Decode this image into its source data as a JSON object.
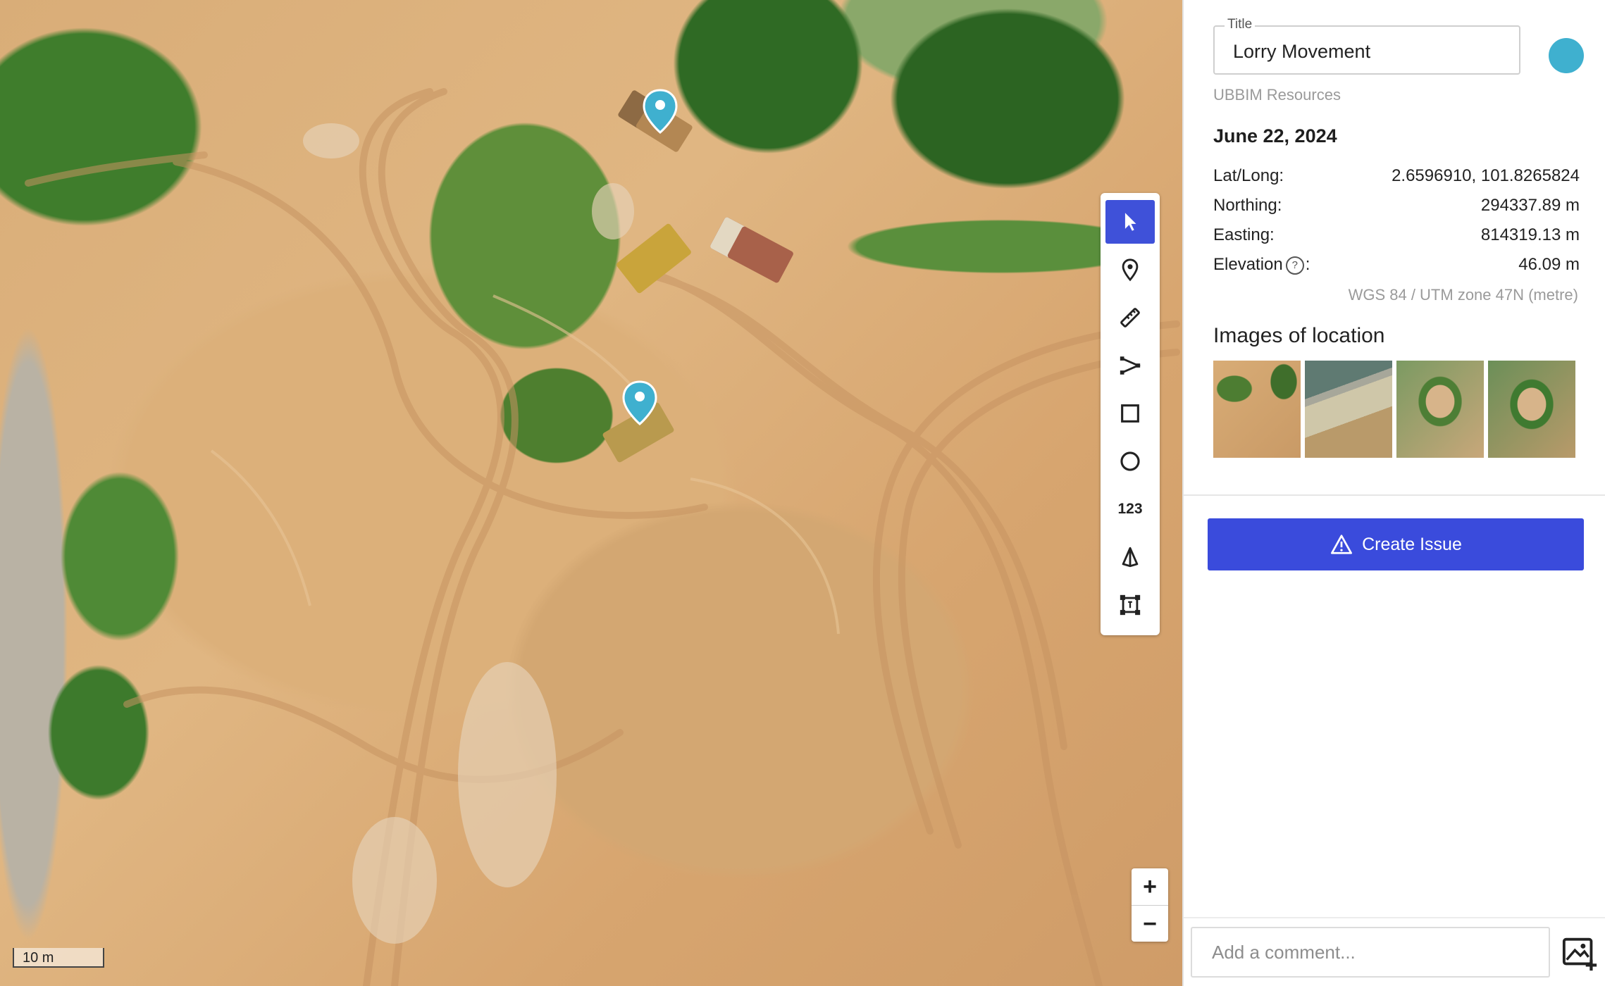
{
  "map": {
    "scale_label": "10 m",
    "zoom_in_label": "+",
    "zoom_out_label": "−",
    "tools": [
      {
        "name": "select-tool",
        "icon": "cursor-arrow-icon",
        "active": true
      },
      {
        "name": "point-tool",
        "icon": "map-pin-icon"
      },
      {
        "name": "distance-tool",
        "icon": "ruler-icon"
      },
      {
        "name": "polyline-tool",
        "icon": "polyline-icon"
      },
      {
        "name": "rectangle-tool",
        "icon": "square-icon"
      },
      {
        "name": "circle-tool",
        "icon": "circle-icon"
      },
      {
        "name": "count-tool",
        "icon": "number-123-icon",
        "label": "123"
      },
      {
        "name": "volume-tool",
        "icon": "cone-icon"
      },
      {
        "name": "area-tool",
        "icon": "area-frame-icon"
      }
    ],
    "accent_color": "#3f51d9",
    "pin_color": "#3fb0cf"
  },
  "panel": {
    "title_legend": "Title",
    "title_value": "Lorry Movement",
    "color_swatch": "#3fb0cf",
    "organization": "UBBIM Resources",
    "date": "June 22, 2024",
    "coords": [
      {
        "label": "Lat/Long:",
        "value": "2.6596910, 101.8265824"
      },
      {
        "label": "Northing:",
        "value": "294337.89 m"
      },
      {
        "label": "Easting:",
        "value": "814319.13 m"
      },
      {
        "label": "Elevation",
        "value": "46.09 m",
        "help": "?"
      }
    ],
    "crs_note": "WGS 84 / UTM zone 47N (metre)",
    "images_heading": "Images of location",
    "create_issue_label": "Create Issue",
    "comment_placeholder": "Add a comment..."
  }
}
